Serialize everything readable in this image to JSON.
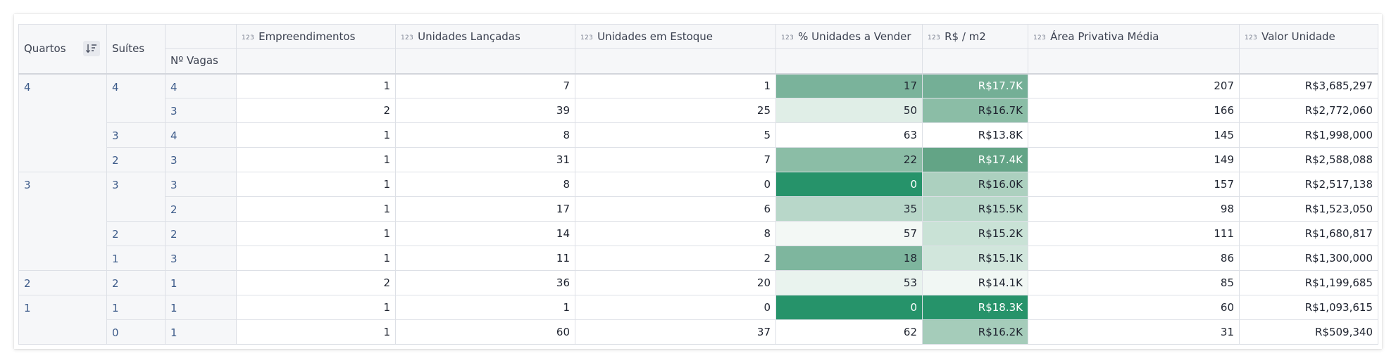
{
  "headers": {
    "quartos": "Quartos",
    "suites": "Suítes",
    "vagas": "Nº Vagas",
    "type_badge": "123",
    "metrics": [
      "Empreendimentos",
      "Unidades Lançadas",
      "Unidades em Estoque",
      "% Unidades a Vender",
      "R$ / m2",
      "Área Privativa Média",
      "Valor Unidade"
    ]
  },
  "icons": {
    "sort": "sort-descending-icon"
  },
  "rows": [
    {
      "quartos": "4",
      "suites": "4",
      "vagas": "4",
      "emp": "1",
      "lanc": "7",
      "est": "1",
      "pct": "17",
      "m2": "R$17.7K",
      "area": "207",
      "valor": "R$3,685,297"
    },
    {
      "quartos": "",
      "suites": "",
      "vagas": "3",
      "emp": "2",
      "lanc": "39",
      "est": "25",
      "pct": "50",
      "m2": "R$16.7K",
      "area": "166",
      "valor": "R$2,772,060"
    },
    {
      "quartos": "",
      "suites": "3",
      "vagas": "4",
      "emp": "1",
      "lanc": "8",
      "est": "5",
      "pct": "63",
      "m2": "R$13.8K",
      "area": "145",
      "valor": "R$1,998,000"
    },
    {
      "quartos": "",
      "suites": "2",
      "vagas": "3",
      "emp": "1",
      "lanc": "31",
      "est": "7",
      "pct": "22",
      "m2": "R$17.4K",
      "area": "149",
      "valor": "R$2,588,088"
    },
    {
      "quartos": "3",
      "suites": "3",
      "vagas": "3",
      "emp": "1",
      "lanc": "8",
      "est": "0",
      "pct": "0",
      "m2": "R$16.0K",
      "area": "157",
      "valor": "R$2,517,138"
    },
    {
      "quartos": "",
      "suites": "",
      "vagas": "2",
      "emp": "1",
      "lanc": "17",
      "est": "6",
      "pct": "35",
      "m2": "R$15.5K",
      "area": "98",
      "valor": "R$1,523,050"
    },
    {
      "quartos": "",
      "suites": "2",
      "vagas": "2",
      "emp": "1",
      "lanc": "14",
      "est": "8",
      "pct": "57",
      "m2": "R$15.2K",
      "area": "111",
      "valor": "R$1,680,817"
    },
    {
      "quartos": "",
      "suites": "1",
      "vagas": "3",
      "emp": "1",
      "lanc": "11",
      "est": "2",
      "pct": "18",
      "m2": "R$15.1K",
      "area": "86",
      "valor": "R$1,300,000"
    },
    {
      "quartos": "2",
      "suites": "2",
      "vagas": "1",
      "emp": "2",
      "lanc": "36",
      "est": "20",
      "pct": "53",
      "m2": "R$14.1K",
      "area": "85",
      "valor": "R$1,199,685"
    },
    {
      "quartos": "1",
      "suites": "1",
      "vagas": "1",
      "emp": "1",
      "lanc": "1",
      "est": "0",
      "pct": "0",
      "m2": "R$18.3K",
      "area": "60",
      "valor": "R$1,093,615"
    },
    {
      "quartos": "",
      "suites": "0",
      "vagas": "1",
      "emp": "1",
      "lanc": "60",
      "est": "37",
      "pct": "62",
      "m2": "R$16.2K",
      "area": "31",
      "valor": "R$509,340"
    }
  ],
  "heatmap": {
    "pct_colors": [
      "#7ab39b",
      "#e0eee7",
      "#ffffff",
      "#8bbda6",
      "#26936a",
      "#b8d7c9",
      "#f3f8f5",
      "#7eb69e",
      "#e9f3ee",
      "#26936a",
      "#ffffff"
    ],
    "pct_text_colors": [
      "#1f2430",
      "#1f2430",
      "#1f2430",
      "#1f2430",
      "#ffffff",
      "#1f2430",
      "#1f2430",
      "#1f2430",
      "#1f2430",
      "#ffffff",
      "#1f2430"
    ],
    "m2_colors": [
      "#74af96",
      "#8bbda6",
      "#ffffff",
      "#63a486",
      "#acd0bf",
      "#bad9cb",
      "#c9e2d6",
      "#d1e6dc",
      "#f1f7f4",
      "#26936a",
      "#a5ccba"
    ],
    "m2_text_colors": [
      "#ffffff",
      "#1f2430",
      "#1f2430",
      "#ffffff",
      "#1f2430",
      "#1f2430",
      "#1f2430",
      "#1f2430",
      "#1f2430",
      "#ffffff",
      "#1f2430"
    ]
  }
}
